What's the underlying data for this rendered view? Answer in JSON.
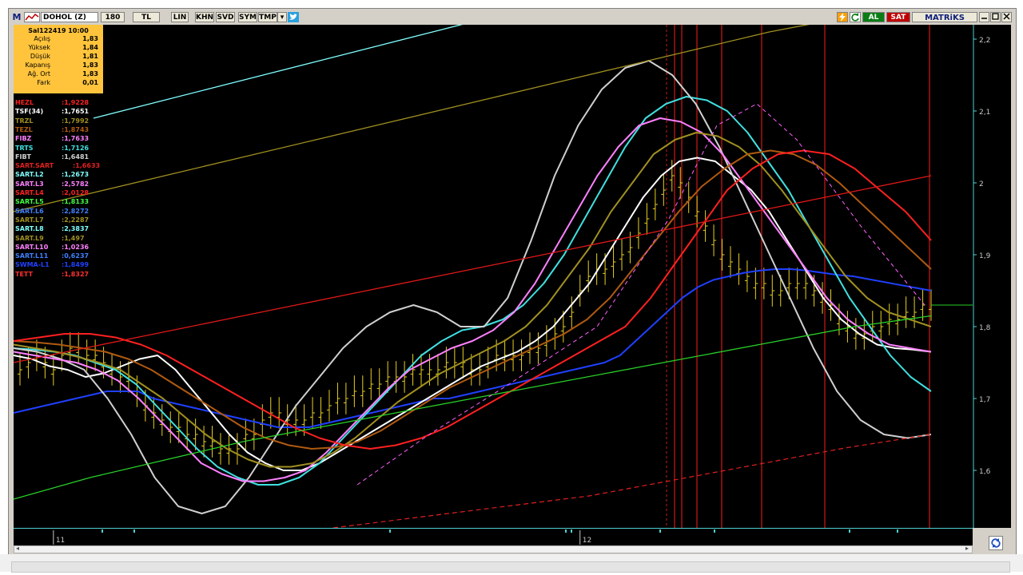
{
  "toolbar": {
    "app_logo": "M",
    "symbol": "DOHOL (Z)",
    "period": "180",
    "currency": "TL",
    "scale_lin": "LIN",
    "btn_khn": "KHN",
    "btn_svd": "SVD",
    "btn_sym": "SYM",
    "btn_tmp": "TMP",
    "btn_al": "AL",
    "btn_sat": "SAT",
    "brand": "MATRiKS",
    "icons": [
      "twitter-icon",
      "lightning-icon",
      "refresh-icon",
      "minimize-icon",
      "maximize-icon",
      "close-icon"
    ]
  },
  "infobox": {
    "date": "Sal122419 10:00",
    "rows": [
      {
        "label": "Açılış",
        "value": "1,83"
      },
      {
        "label": "Yüksek",
        "value": "1,84"
      },
      {
        "label": "Düşük",
        "value": "1,81"
      },
      {
        "label": "Kapanış",
        "value": "1,83"
      },
      {
        "label": "Ağ. Ort",
        "value": "1,83"
      },
      {
        "label": "Fark",
        "value": "0,01"
      }
    ]
  },
  "legend": [
    {
      "name": "HEZL",
      "value": ":1,9228",
      "color": "#ff2020"
    },
    {
      "name": "TSF(34)",
      "value": ":1,7651",
      "color": "#ffffff"
    },
    {
      "name": "TRZL",
      "value": ":1,7992",
      "color": "#a09020"
    },
    {
      "name": "TEZL",
      "value": ":1,8743",
      "color": "#b05a10"
    },
    {
      "name": "FIBZ",
      "value": ":1,7633",
      "color": "#ff80ff"
    },
    {
      "name": "TRTS",
      "value": ":1,7126",
      "color": "#40e0e0"
    },
    {
      "name": "FIBT",
      "value": ":1,6481",
      "color": "#d0d0d0"
    },
    {
      "name": "SART.SART",
      "value": ":1,6633",
      "color": "#e02020"
    },
    {
      "name": "SART.L2",
      "value": ":1,2673",
      "color": "#80ffff"
    },
    {
      "name": "SART.L3",
      "value": ":2,5782",
      "color": "#ff80ff"
    },
    {
      "name": "SART.L4",
      "value": ":2,0128",
      "color": "#ff2020"
    },
    {
      "name": "SART.L5",
      "value": ":1,8133",
      "color": "#40ff40"
    },
    {
      "name": "SART.L6",
      "value": ":2,8272",
      "color": "#4080ff"
    },
    {
      "name": "SART.L7",
      "value": ":2,2287",
      "color": "#a09020"
    },
    {
      "name": "SART.L8",
      "value": ":2,3837",
      "color": "#80ffff"
    },
    {
      "name": "SART.L9",
      "value": ":1,497",
      "color": "#a09020"
    },
    {
      "name": "SART.L10",
      "value": ":1,0236",
      "color": "#ff80ff"
    },
    {
      "name": "SART.L11",
      "value": ":0,6237",
      "color": "#4080ff"
    },
    {
      "name": "SWMA-L1",
      "value": ":1,8499",
      "color": "#2040ff"
    },
    {
      "name": "TETT",
      "value": ":1,8327",
      "color": "#ff3030"
    }
  ],
  "chart_data": {
    "type": "line",
    "ylim": [
      1.52,
      2.22
    ],
    "y_ticks": [
      "2,2",
      "2,1",
      "2",
      "1,9",
      "1,8",
      "1,7",
      "1,6"
    ],
    "y_tick_values": [
      2.2,
      2.1,
      2.0,
      1.9,
      1.8,
      1.7,
      1.6
    ],
    "x_tick_labels": [
      "11",
      "12"
    ],
    "x_tick_index": [
      4,
      67
    ],
    "last_price": 1.83,
    "price_bars_close": [
      1.74,
      1.75,
      1.76,
      1.75,
      1.74,
      1.76,
      1.77,
      1.77,
      1.76,
      1.76,
      1.75,
      1.74,
      1.73,
      1.73,
      1.71,
      1.69,
      1.68,
      1.67,
      1.66,
      1.66,
      1.65,
      1.65,
      1.64,
      1.64,
      1.63,
      1.63,
      1.63,
      1.65,
      1.65,
      1.67,
      1.68,
      1.68,
      1.67,
      1.67,
      1.67,
      1.68,
      1.68,
      1.69,
      1.7,
      1.7,
      1.71,
      1.71,
      1.72,
      1.72,
      1.73,
      1.73,
      1.73,
      1.74,
      1.74,
      1.74,
      1.74,
      1.75,
      1.75,
      1.75,
      1.74,
      1.74,
      1.75,
      1.76,
      1.76,
      1.76,
      1.76,
      1.77,
      1.77,
      1.78,
      1.79,
      1.8,
      1.82,
      1.85,
      1.87,
      1.88,
      1.88,
      1.89,
      1.9,
      1.91,
      1.93,
      1.95,
      1.97,
      1.99,
      2.01,
      2.0,
      1.98,
      1.96,
      1.94,
      1.92,
      1.9,
      1.89,
      1.88,
      1.87,
      1.86,
      1.86,
      1.85,
      1.85,
      1.86,
      1.86,
      1.86,
      1.85,
      1.84,
      1.83,
      1.81,
      1.8,
      1.79,
      1.79,
      1.8,
      1.8,
      1.81,
      1.81,
      1.82,
      1.82,
      1.83,
      1.83
    ],
    "series": [
      {
        "name": "SWMA-L1",
        "color": "#2040ff",
        "width": 2,
        "values": [
          1.68,
          1.685,
          1.69,
          1.695,
          1.7,
          1.705,
          1.71,
          1.71,
          1.71,
          1.7,
          1.695,
          1.69,
          1.685,
          1.68,
          1.675,
          1.67,
          1.665,
          1.66,
          1.66,
          1.66,
          1.665,
          1.67,
          1.675,
          1.68,
          1.685,
          1.69,
          1.695,
          1.7,
          1.7,
          1.705,
          1.71,
          1.715,
          1.72,
          1.725,
          1.73,
          1.735,
          1.74,
          1.745,
          1.75,
          1.76,
          1.78,
          1.8,
          1.82,
          1.84,
          1.855,
          1.865,
          1.87,
          1.875,
          1.878,
          1.88,
          1.88,
          1.878,
          1.875,
          1.872,
          1.87,
          1.866,
          1.862,
          1.858,
          1.854,
          1.85
        ]
      },
      {
        "name": "TSF(34)",
        "color": "#ffffff",
        "width": 2,
        "values": [
          1.76,
          1.755,
          1.745,
          1.74,
          1.73,
          1.735,
          1.745,
          1.755,
          1.76,
          1.74,
          1.71,
          1.68,
          1.65,
          1.625,
          1.61,
          1.6,
          1.6,
          1.61,
          1.625,
          1.64,
          1.655,
          1.67,
          1.685,
          1.7,
          1.715,
          1.73,
          1.745,
          1.755,
          1.765,
          1.78,
          1.8,
          1.83,
          1.86,
          1.9,
          1.94,
          1.98,
          2.01,
          2.03,
          2.035,
          2.03,
          2.01,
          1.99,
          1.96,
          1.92,
          1.88,
          1.84,
          1.81,
          1.79,
          1.775,
          1.77,
          1.768,
          1.765
        ]
      },
      {
        "name": "TRTS",
        "color": "#40e0e0",
        "width": 2,
        "values": [
          1.77,
          1.768,
          1.765,
          1.76,
          1.75,
          1.74,
          1.72,
          1.69,
          1.66,
          1.63,
          1.605,
          1.59,
          1.58,
          1.58,
          1.59,
          1.61,
          1.64,
          1.67,
          1.7,
          1.73,
          1.76,
          1.78,
          1.795,
          1.8,
          1.81,
          1.83,
          1.86,
          1.9,
          1.95,
          2.0,
          2.05,
          2.09,
          2.11,
          2.12,
          2.115,
          2.1,
          2.07,
          2.03,
          1.99,
          1.94,
          1.89,
          1.84,
          1.8,
          1.76,
          1.73,
          1.71
        ]
      },
      {
        "name": "FIBT",
        "color": "#d0d0d0",
        "width": 2,
        "values": [
          1.77,
          1.765,
          1.755,
          1.74,
          1.7,
          1.65,
          1.59,
          1.55,
          1.54,
          1.55,
          1.59,
          1.64,
          1.69,
          1.73,
          1.77,
          1.8,
          1.82,
          1.83,
          1.82,
          1.8,
          1.8,
          1.84,
          1.92,
          2.01,
          2.08,
          2.13,
          2.16,
          2.17,
          2.15,
          2.11,
          2.05,
          1.98,
          1.91,
          1.84,
          1.77,
          1.71,
          1.67,
          1.65,
          1.645,
          1.65
        ]
      },
      {
        "name": "FIBZ",
        "color": "#ff80ff",
        "width": 2,
        "values": [
          1.765,
          1.76,
          1.755,
          1.75,
          1.74,
          1.725,
          1.7,
          1.67,
          1.64,
          1.61,
          1.595,
          1.585,
          1.585,
          1.59,
          1.6,
          1.625,
          1.655,
          1.685,
          1.715,
          1.74,
          1.755,
          1.77,
          1.78,
          1.795,
          1.82,
          1.86,
          1.91,
          1.96,
          2.01,
          2.05,
          2.08,
          2.09,
          2.085,
          2.07,
          2.04,
          2.0,
          1.96,
          1.92,
          1.88,
          1.84,
          1.81,
          1.79,
          1.775,
          1.77,
          1.765
        ]
      },
      {
        "name": "TRZL",
        "color": "#a09020",
        "width": 2,
        "values": [
          1.775,
          1.77,
          1.765,
          1.758,
          1.75,
          1.74,
          1.72,
          1.7,
          1.675,
          1.65,
          1.63,
          1.615,
          1.605,
          1.605,
          1.61,
          1.625,
          1.645,
          1.67,
          1.695,
          1.715,
          1.735,
          1.75,
          1.765,
          1.78,
          1.8,
          1.83,
          1.87,
          1.91,
          1.96,
          2.0,
          2.04,
          2.06,
          2.07,
          2.065,
          2.05,
          2.025,
          1.99,
          1.95,
          1.91,
          1.87,
          1.84,
          1.82,
          1.81,
          1.8
        ]
      },
      {
        "name": "TEZL",
        "color": "#b05a10",
        "width": 2,
        "values": [
          1.78,
          1.778,
          1.775,
          1.77,
          1.765,
          1.755,
          1.74,
          1.72,
          1.7,
          1.68,
          1.66,
          1.645,
          1.635,
          1.63,
          1.632,
          1.64,
          1.655,
          1.675,
          1.695,
          1.715,
          1.73,
          1.745,
          1.76,
          1.775,
          1.79,
          1.81,
          1.84,
          1.88,
          1.92,
          1.96,
          1.995,
          2.02,
          2.04,
          2.045,
          2.04,
          2.025,
          2.0,
          1.97,
          1.94,
          1.91,
          1.88
        ]
      },
      {
        "name": "HEZL",
        "color": "#ff2020",
        "width": 2,
        "values": [
          1.78,
          1.785,
          1.79,
          1.79,
          1.785,
          1.775,
          1.76,
          1.74,
          1.72,
          1.7,
          1.68,
          1.66,
          1.645,
          1.635,
          1.63,
          1.635,
          1.645,
          1.66,
          1.68,
          1.7,
          1.72,
          1.74,
          1.76,
          1.78,
          1.8,
          1.84,
          1.89,
          1.94,
          1.99,
          2.02,
          2.04,
          2.045,
          2.04,
          2.02,
          1.99,
          1.96,
          1.92
        ]
      },
      {
        "name": "SART.L4",
        "color": "#e01818",
        "width": 1.3,
        "values": [
          1.75,
          1.77,
          1.79,
          1.81,
          1.83,
          1.85,
          1.87,
          1.89,
          1.91,
          1.93,
          1.95,
          1.97,
          1.99,
          2.01
        ]
      },
      {
        "name": "SART.L5",
        "color": "#28d028",
        "width": 1.3,
        "values": [
          1.56,
          1.59,
          1.615,
          1.64,
          1.66,
          1.68,
          1.7,
          1.72,
          1.74,
          1.76,
          1.78,
          1.8,
          1.815
        ]
      },
      {
        "name": "SART.L7",
        "color": "#a09020",
        "width": 1.3,
        "values": [
          1.96,
          1.985,
          2.01,
          2.035,
          2.06,
          2.085,
          2.11,
          2.135,
          2.16,
          2.185,
          2.21,
          2.23
        ]
      },
      {
        "name": "SART.L2",
        "color": "#80ffff",
        "width": 1.3,
        "values": [
          2.09,
          2.11,
          2.13,
          2.15,
          2.17,
          2.19,
          2.21,
          2.23
        ]
      }
    ]
  }
}
